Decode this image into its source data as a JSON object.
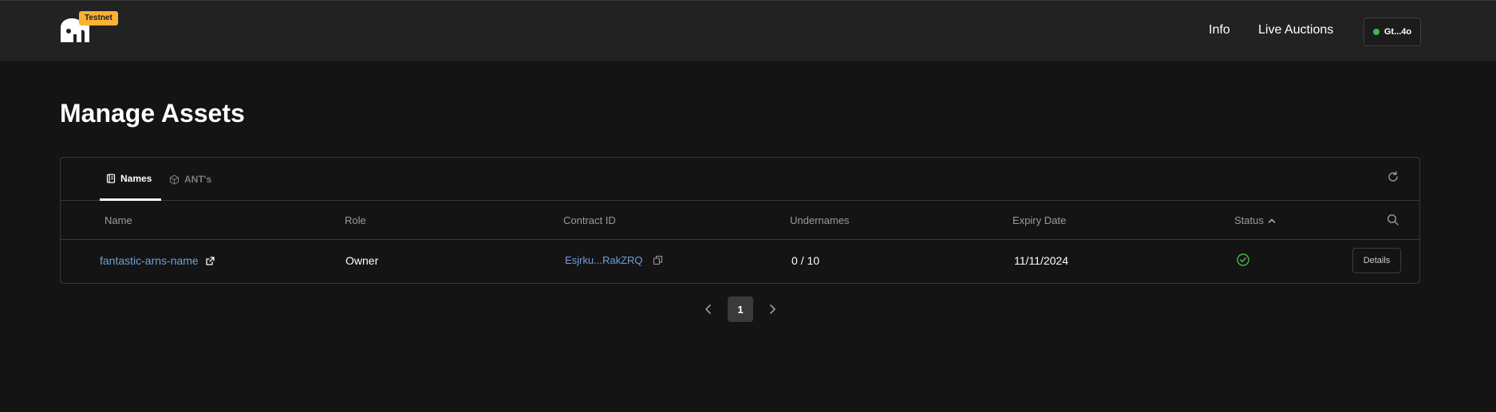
{
  "header": {
    "badge": "Testnet",
    "nav": {
      "info": "Info",
      "live_auctions": "Live Auctions"
    },
    "wallet_label": "Gt...4o"
  },
  "page": {
    "title": "Manage Assets"
  },
  "tabs": [
    {
      "label": "Names",
      "icon": "book-icon",
      "active": true
    },
    {
      "label": "ANT's",
      "icon": "cube-icon",
      "active": false
    }
  ],
  "table": {
    "columns": [
      "Name",
      "Role",
      "Contract ID",
      "Undernames",
      "Expiry Date",
      "Status"
    ],
    "sort": {
      "column": "Status",
      "direction": "asc"
    },
    "rows": [
      {
        "name": "fantastic-arns-name",
        "role": "Owner",
        "contract_id": "Esjrku...RakZRQ",
        "undernames": "0 / 10",
        "expiry": "11/11/2024",
        "status_icon": "check-circle-icon",
        "action": "Details"
      }
    ]
  },
  "pagination": {
    "current": "1"
  },
  "colors": {
    "accent_link": "#6f9fd8",
    "badge": "#f9b231",
    "status_ok": "#3fb950"
  }
}
